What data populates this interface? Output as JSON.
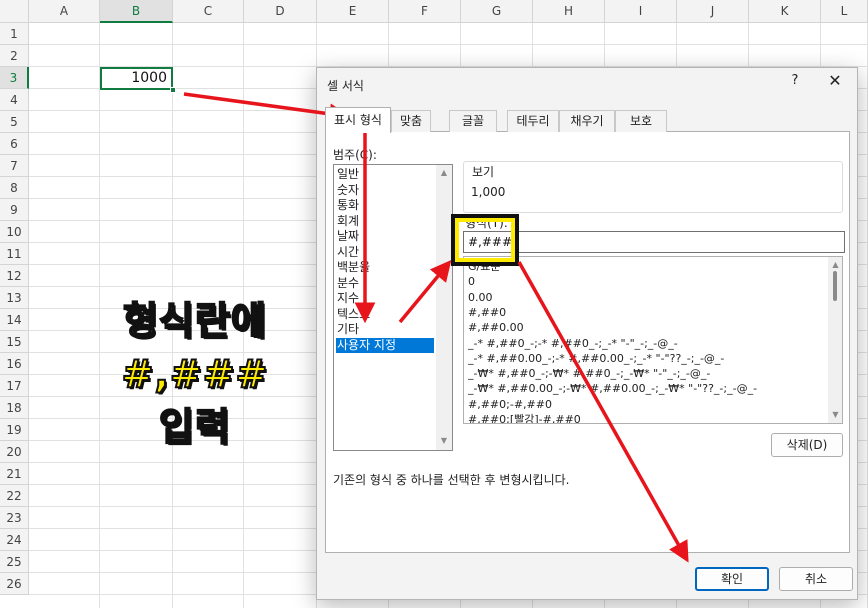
{
  "sheet": {
    "columns": [
      "A",
      "B",
      "C",
      "D",
      "E",
      "F",
      "G",
      "H",
      "I",
      "J",
      "K",
      "L"
    ],
    "rows": [
      "1",
      "2",
      "3",
      "4",
      "5",
      "6",
      "7",
      "8",
      "9",
      "10",
      "11",
      "12",
      "13",
      "14",
      "15",
      "16",
      "17",
      "18",
      "19",
      "20",
      "21",
      "22",
      "23",
      "24",
      "25",
      "26"
    ],
    "active_col": "B",
    "active_row": "3",
    "cell_b3_value": "1000"
  },
  "annotation": {
    "lines": [
      "형식란에",
      "#,###",
      "입력"
    ],
    "color": "#ffeb00"
  },
  "dialog": {
    "title": "셀 서식",
    "help_label": "?",
    "close_label": "✕",
    "tabs": [
      {
        "label": "표시 형식",
        "active": true
      },
      {
        "label": "맞춤",
        "active": false
      },
      {
        "label": "글꼴",
        "active": false
      },
      {
        "label": "테두리",
        "active": false
      },
      {
        "label": "채우기",
        "active": false
      },
      {
        "label": "보호",
        "active": false
      }
    ],
    "category_label": "범주(C):",
    "categories": [
      "일반",
      "숫자",
      "통화",
      "회계",
      "날짜",
      "시간",
      "백분율",
      "분수",
      "지수",
      "텍스트",
      "기타",
      "사용자 지정"
    ],
    "selected_category": "사용자 지정",
    "sample_label": "보기",
    "sample_value": "1,000",
    "type_label": "형식(T):",
    "type_value": "#,###",
    "format_list": [
      "G/표준",
      "0",
      "0.00",
      "#,##0",
      "#,##0.00",
      "_-* #,##0_-;-* #,##0_-;_-* \"-\"_-;_-@_-",
      "_-* #,##0.00_-;-* #,##0.00_-;_-* \"-\"??_-;_-@_-",
      "_-₩* #,##0_-;-₩* #,##0_-;_-₩* \"-\"_-;_-@_-",
      "_-₩* #,##0.00_-;-₩* #,##0.00_-;_-₩* \"-\"??_-;_-@_-",
      "#,##0;-#,##0",
      "#,##0;[빨강]-#,##0"
    ],
    "delete_button": "삭제(D)",
    "description": "기존의 형식 중 하나를 선택한 후 변형시킵니다.",
    "ok_button": "확인",
    "cancel_button": "취소"
  },
  "colors": {
    "accent": "#107c41",
    "arrow": "#e8141c",
    "highlight": "#ffeb00",
    "selection": "#0078d7"
  }
}
